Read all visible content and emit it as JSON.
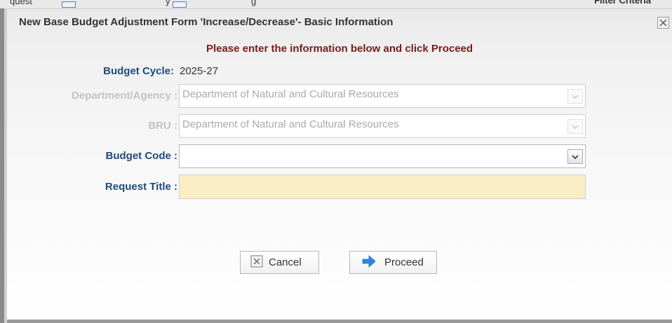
{
  "background": {
    "left_text": "quest",
    "mid_text": "y",
    "mid_text2": "g",
    "right_text": "Filter Criteria"
  },
  "dialog": {
    "title": "New Base Budget Adjustment Form 'Increase/Decrease'- Basic Information",
    "instruction": "Please enter the information below and click Proceed"
  },
  "form": {
    "budget_cycle": {
      "label": "Budget Cycle",
      "separator": ":",
      "value": "2025-27"
    },
    "department": {
      "label": "Department/Agency :",
      "value": "Department of Natural and Cultural Resources"
    },
    "bru": {
      "label": "BRU :",
      "value": "Department of Natural and Cultural Resources"
    },
    "budget_code": {
      "label": "Budget Code :",
      "value": ""
    },
    "request_title": {
      "label": "Request Title :",
      "value": "",
      "placeholder": ""
    }
  },
  "buttons": {
    "cancel_label": "Cancel",
    "proceed_label": "Proceed"
  },
  "colors": {
    "label_blue": "#1f4b7a",
    "instruction_red": "#7a1a1a",
    "disabled_gray": "#c3c3c3",
    "required_input_bg": "#fbeec4",
    "proceed_arrow": "#2f86d8"
  },
  "icons": {
    "close": "close-icon",
    "cancel": "x-box-icon",
    "proceed": "arrow-right-icon",
    "dropdown": "chevron-down-icon"
  }
}
